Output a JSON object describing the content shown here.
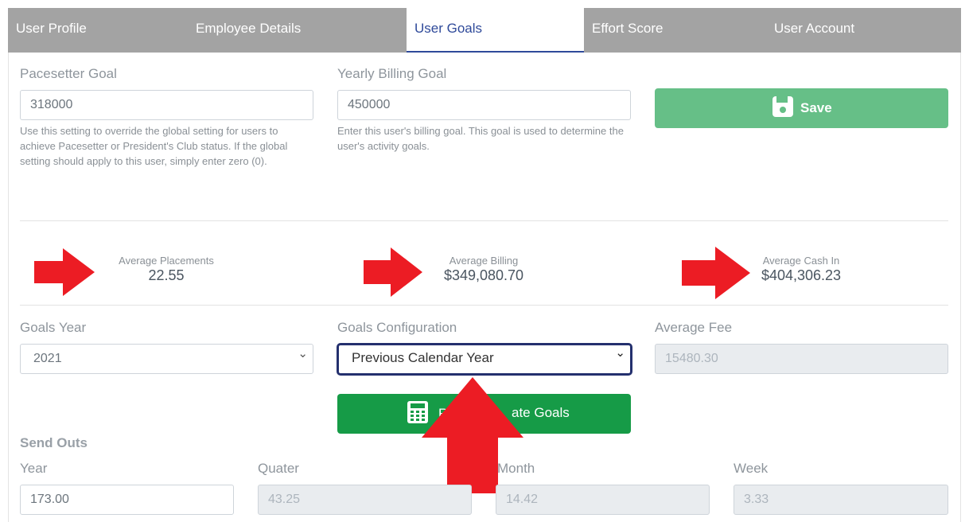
{
  "tabs": [
    {
      "label": "User Profile"
    },
    {
      "label": "Employee Details"
    },
    {
      "label": "User Goals"
    },
    {
      "label": "Effort Score"
    },
    {
      "label": "User Account"
    }
  ],
  "pacesetter": {
    "label": "Pacesetter Goal",
    "value": "318000",
    "help": "Use this setting to override the global setting for users to achieve Pacesetter or President's Club status. If the global setting should apply to this user, simply enter zero (0)."
  },
  "billing_goal": {
    "label": "Yearly Billing Goal",
    "value": "450000",
    "help": "Enter this user's billing goal. This goal is used to determine the user's activity goals."
  },
  "save_button": {
    "label": "Save"
  },
  "stats": {
    "placements": {
      "label": "Average Placements",
      "value": "22.55"
    },
    "billing": {
      "label": "Average Billing",
      "value": "$349,080.70"
    },
    "cash_in": {
      "label": "Average Cash In",
      "value": "$404,306.23"
    }
  },
  "goals_year": {
    "label": "Goals Year",
    "value": "2021"
  },
  "goals_config": {
    "label": "Goals Configuration",
    "value": "Previous Calendar Year"
  },
  "average_fee": {
    "label": "Average Fee",
    "value": "15480.30"
  },
  "calc_button": {
    "label": "Recalculate Goals",
    "visible_left": "R",
    "visible_right": "ate Goals"
  },
  "send_outs": {
    "title": "Send Outs",
    "year": {
      "label": "Year",
      "value": "173.00"
    },
    "quarter": {
      "label": "Quater",
      "value": "43.25"
    },
    "month": {
      "label": "Month",
      "value": "14.42"
    },
    "week": {
      "label": "Week",
      "value": "3.33"
    }
  },
  "colors": {
    "tab_bar": "#a3a3a3",
    "active_tab_text": "#2f4a9a",
    "save_button": "#66bf87",
    "calc_button": "#169b47",
    "annotation_arrow": "#ec1c24"
  },
  "icons": {
    "save": "floppy-disk-icon",
    "calc": "calculator-icon",
    "select": "chevron-down-icon"
  }
}
